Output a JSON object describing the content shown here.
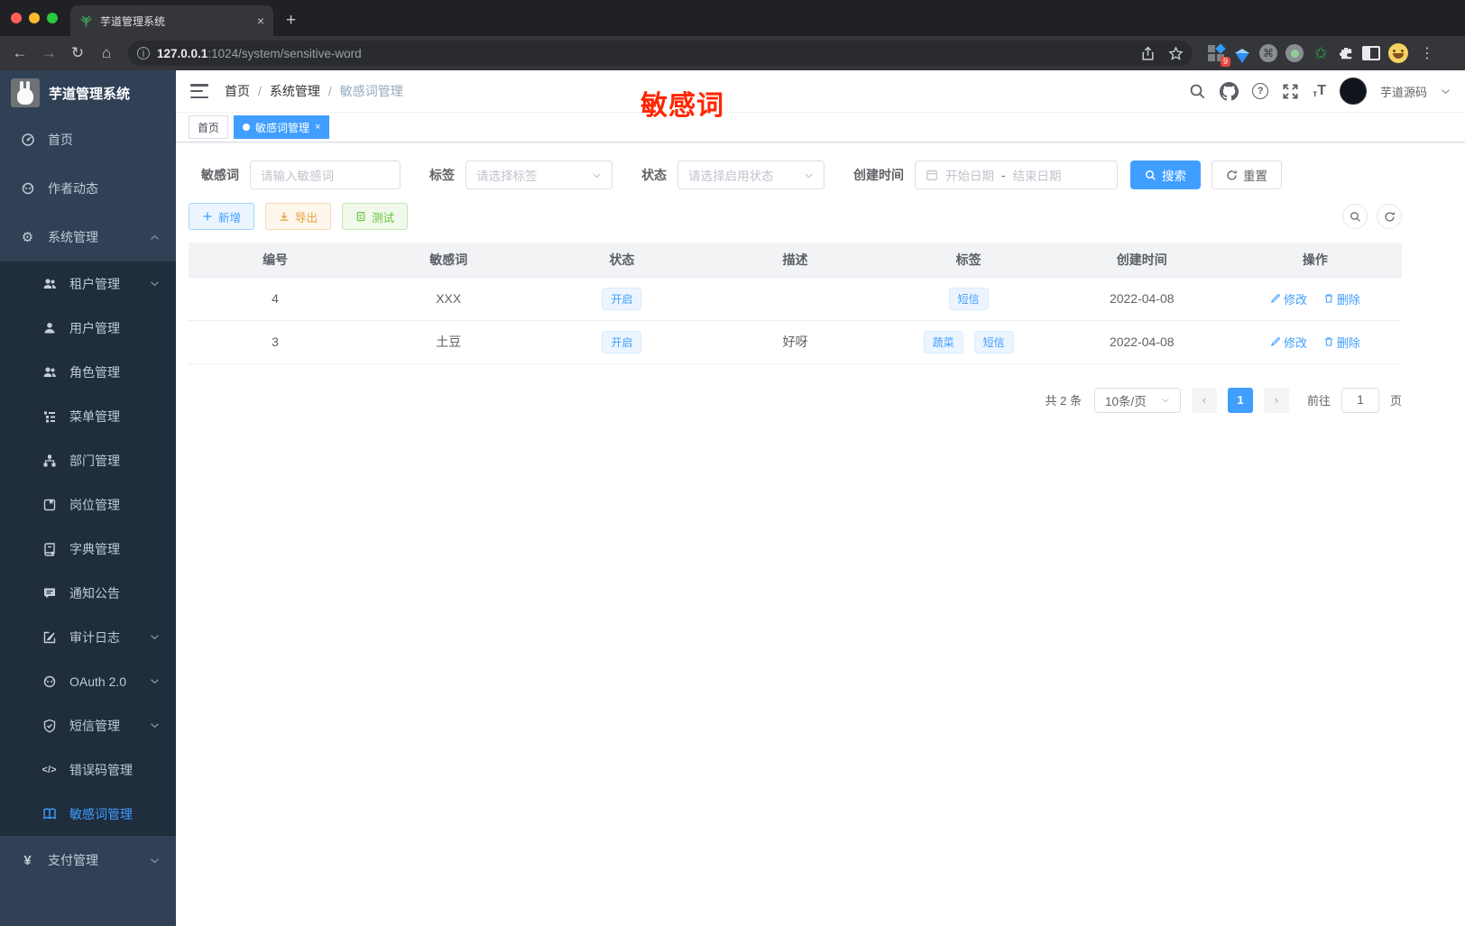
{
  "browser": {
    "tab_title": "芋道管理系统",
    "tab_close": "×",
    "new_tab": "+",
    "back": "←",
    "forward": "→",
    "reload": "↻",
    "home": "⌂",
    "url_info": "ⓘ",
    "url_host": "127.0.0.1",
    "url_rest": ":1024/system/sensitive-word",
    "extension_badge": "9",
    "cmd_glyph": "⌘",
    "star_glyph": "✩",
    "menu_dots": "⋮"
  },
  "sidebar": {
    "logo_title": "芋道管理系统",
    "items": [
      {
        "label": "首页"
      },
      {
        "label": "作者动态"
      },
      {
        "label": "系统管理"
      },
      {
        "label": "租户管理"
      },
      {
        "label": "用户管理"
      },
      {
        "label": "角色管理"
      },
      {
        "label": "菜单管理"
      },
      {
        "label": "部门管理"
      },
      {
        "label": "岗位管理"
      },
      {
        "label": "字典管理"
      },
      {
        "label": "通知公告"
      },
      {
        "label": "审计日志"
      },
      {
        "label": "OAuth 2.0"
      },
      {
        "label": "短信管理"
      },
      {
        "label": "错误码管理"
      },
      {
        "label": "敏感词管理"
      },
      {
        "label": "支付管理"
      }
    ],
    "code_glyph": "</>",
    "yen_glyph": "¥",
    "gear_glyph": "⚙"
  },
  "header": {
    "breadcrumb": [
      "首页",
      "系统管理",
      "敏感词管理"
    ],
    "sep": "/",
    "annotation": "敏感词",
    "help_glyph": "?",
    "font_small": "т",
    "font_large": "T",
    "user_name": "芋道源码"
  },
  "tags": {
    "home": "首页",
    "current": "敏感词管理",
    "close": "×"
  },
  "filters": {
    "keyword_label": "敏感词",
    "keyword_placeholder": "请输入敏感词",
    "tag_label": "标签",
    "tag_placeholder": "请选择标签",
    "status_label": "状态",
    "status_placeholder": "请选择启用状态",
    "date_label": "创建时间",
    "date_start_placeholder": "开始日期",
    "date_separator": "-",
    "date_end_placeholder": "结束日期",
    "search_label": "搜索",
    "reset_label": "重置"
  },
  "toolbar": {
    "add_label": "新增",
    "export_label": "导出",
    "test_label": "测试"
  },
  "table": {
    "columns": [
      "编号",
      "敏感词",
      "状态",
      "描述",
      "标签",
      "创建时间",
      "操作"
    ],
    "edit_label": "修改",
    "delete_label": "删除",
    "rows": [
      {
        "id": "4",
        "word": "XXX",
        "status": "开启",
        "desc": "",
        "tags": [
          "短信"
        ],
        "created": "2022-04-08"
      },
      {
        "id": "3",
        "word": "土豆",
        "status": "开启",
        "desc": "好呀",
        "tags": [
          "蔬菜",
          "短信"
        ],
        "created": "2022-04-08"
      }
    ]
  },
  "pagination": {
    "total": "共 2 条",
    "page_size": "10条/页",
    "prev": "‹",
    "next": "›",
    "page": "1",
    "goto_label": "前往",
    "goto_value": "1",
    "page_suffix": "页"
  }
}
